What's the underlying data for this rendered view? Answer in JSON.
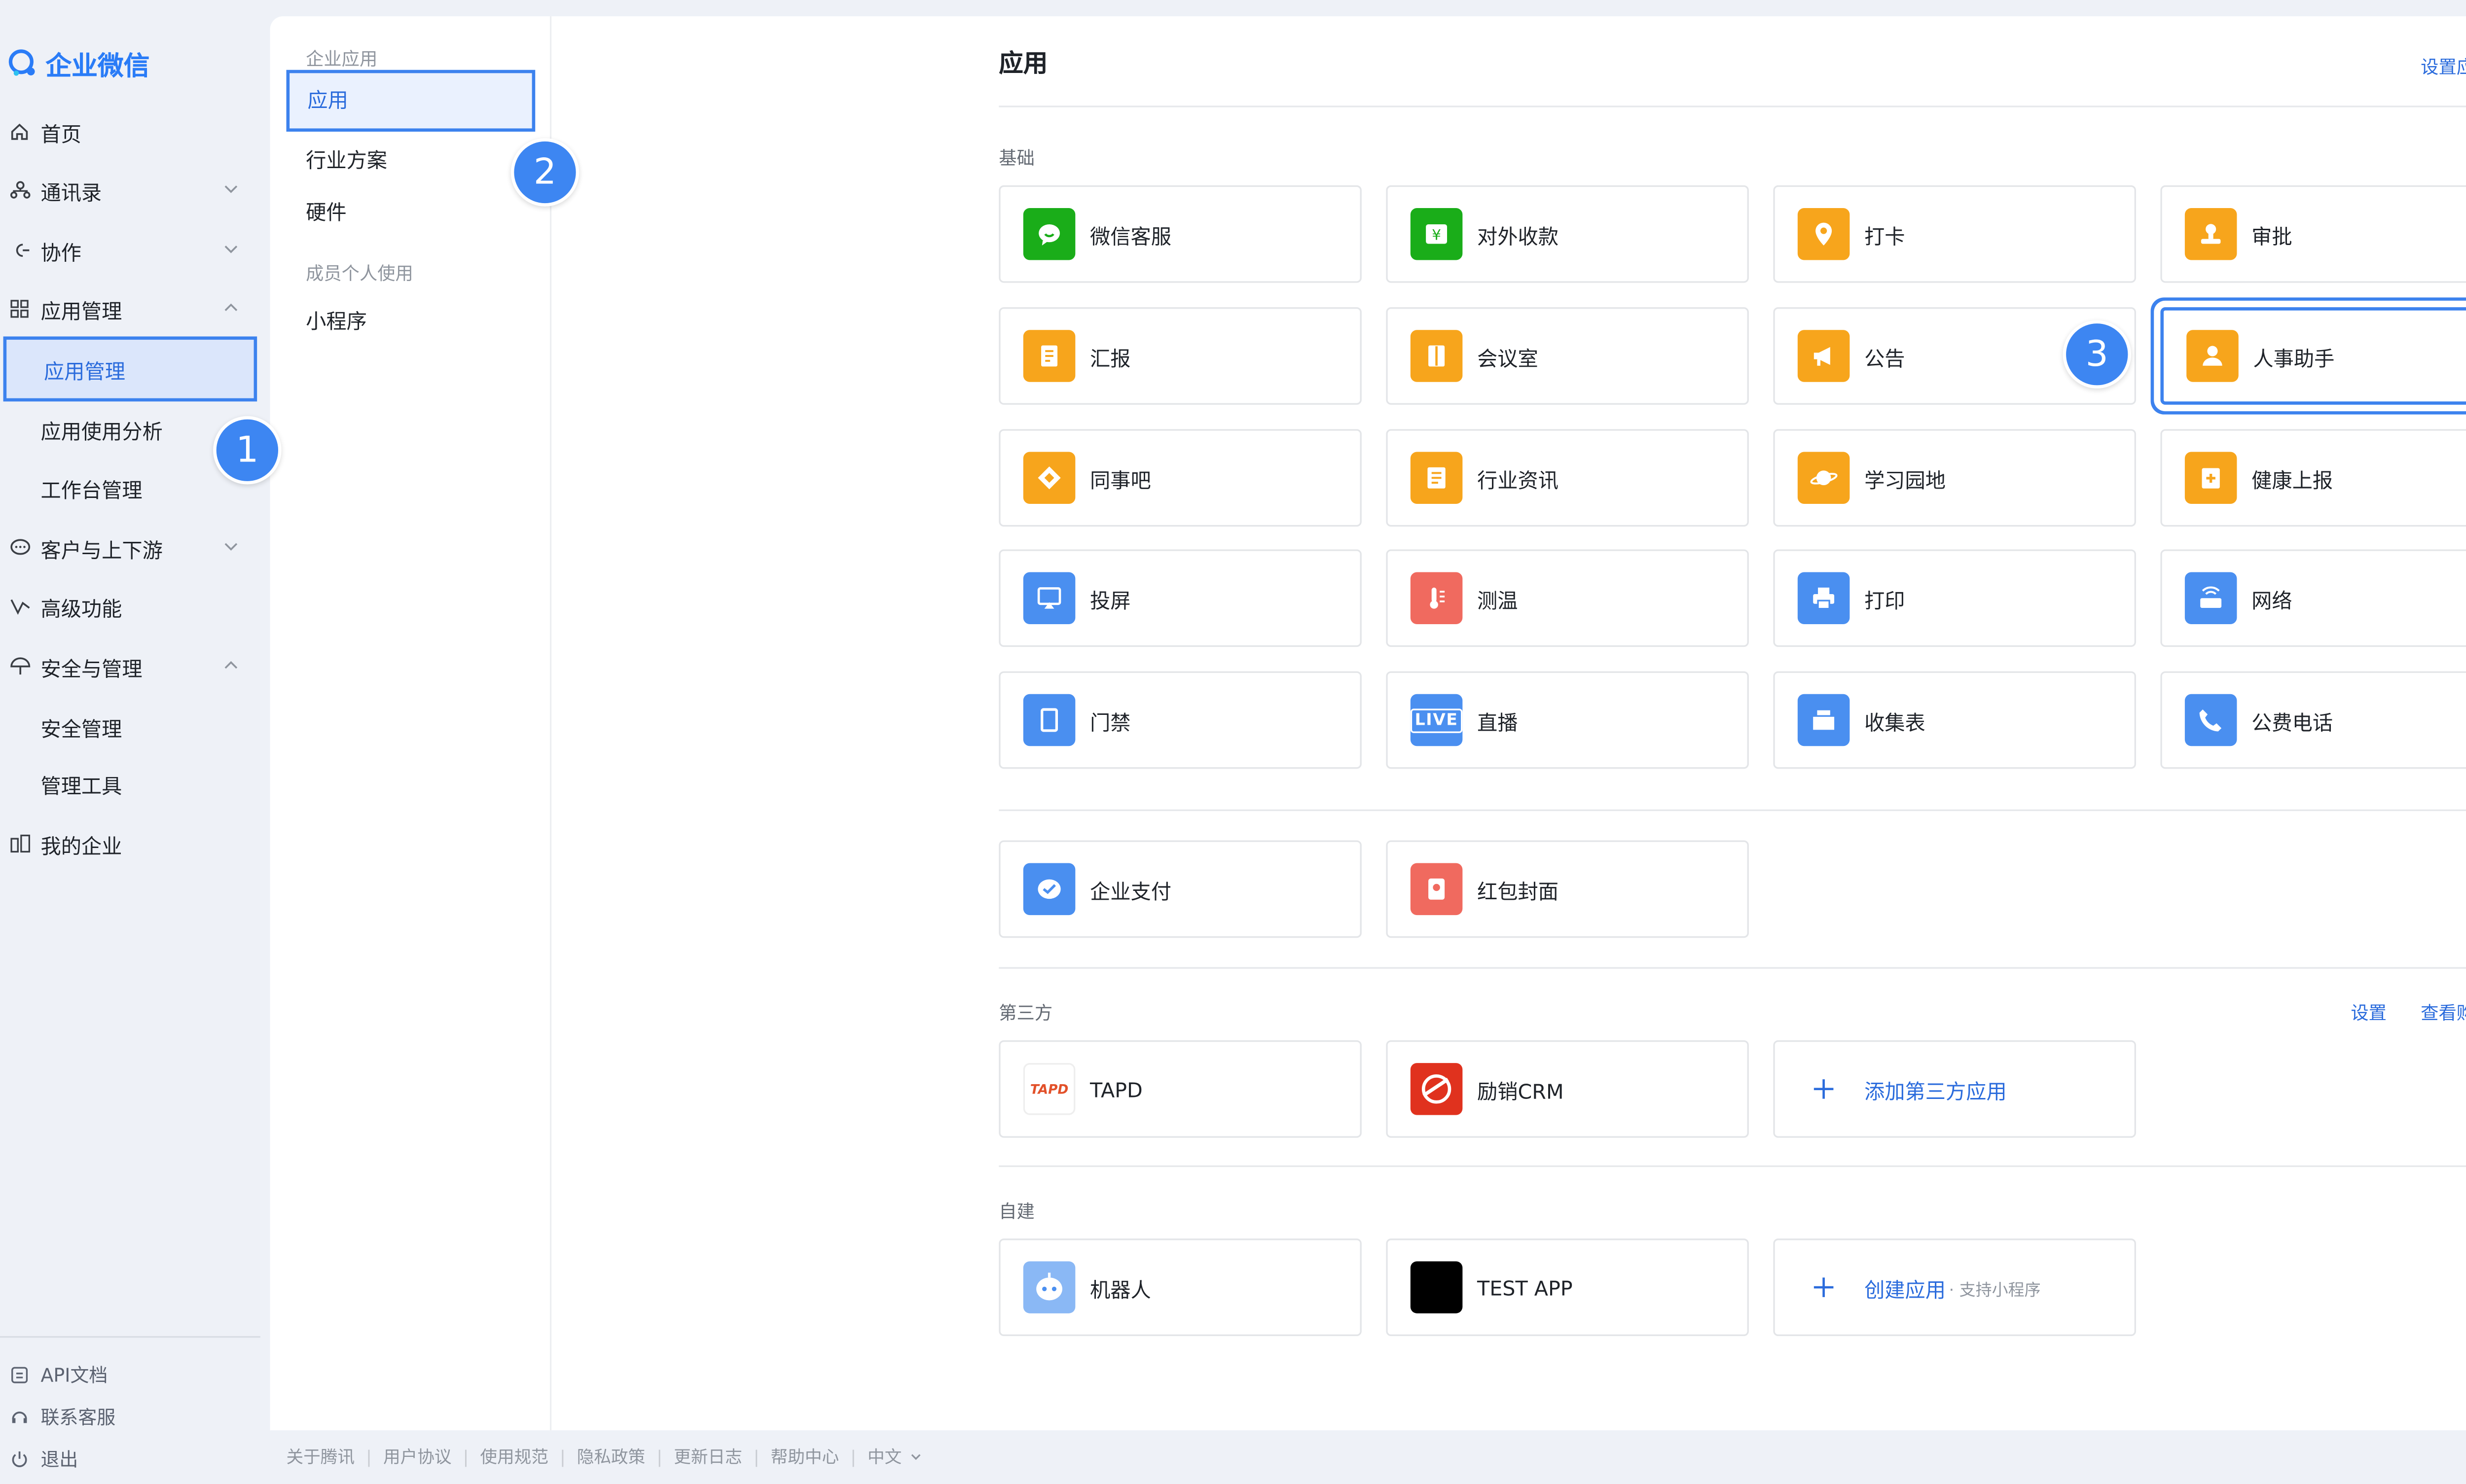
{
  "brand": {
    "name": "企业微信",
    "color": "#2a7cf7"
  },
  "sidebar": {
    "items": [
      {
        "label": "首页",
        "icon": "home-icon"
      },
      {
        "label": "通讯录",
        "icon": "contacts-icon",
        "expand": "down"
      },
      {
        "label": "协作",
        "icon": "collab-icon",
        "expand": "down"
      },
      {
        "label": "应用管理",
        "icon": "apps-grid-icon",
        "expand": "up"
      },
      {
        "label": "应用管理",
        "sub": true,
        "active": true
      },
      {
        "label": "应用使用分析",
        "sub": true
      },
      {
        "label": "工作台管理",
        "sub": true
      },
      {
        "label": "客户与上下游",
        "icon": "chat-bubble-icon",
        "expand": "down"
      },
      {
        "label": "高级功能",
        "icon": "advanced-icon"
      },
      {
        "label": "安全与管理",
        "icon": "umbrella-icon",
        "expand": "up"
      },
      {
        "label": "安全管理",
        "sub": true
      },
      {
        "label": "管理工具",
        "sub": true
      },
      {
        "label": "我的企业",
        "icon": "building-icon"
      }
    ],
    "bottom": [
      {
        "label": "API文档",
        "icon": "api-doc-icon"
      },
      {
        "label": "联系客服",
        "icon": "headset-icon"
      },
      {
        "label": "退出",
        "icon": "power-icon"
      }
    ]
  },
  "subnav": {
    "group1": "企业应用",
    "items1": [
      "应用",
      "行业方案",
      "硬件"
    ],
    "group2": "成员个人使用",
    "items2": [
      "小程序"
    ]
  },
  "badges": [
    "1",
    "2",
    "3"
  ],
  "main": {
    "title": "应用",
    "set_group_link": "设置应用分组",
    "basic_label": "基础",
    "basic_apps": [
      {
        "label": "微信客服",
        "color": "#1aad19",
        "icon": "wechat-service-icon"
      },
      {
        "label": "对外收款",
        "color": "#1aad19",
        "icon": "payment-receive-icon"
      },
      {
        "label": "打卡",
        "color": "#f7a51c",
        "icon": "location-pin-icon"
      },
      {
        "label": "审批",
        "color": "#f7a51c",
        "icon": "approval-stamp-icon"
      },
      {
        "label": "汇报",
        "color": "#f7a51c",
        "icon": "report-doc-icon"
      },
      {
        "label": "会议室",
        "color": "#f7a51c",
        "icon": "meeting-room-icon"
      },
      {
        "label": "公告",
        "color": "#f7a51c",
        "icon": "megaphone-icon"
      },
      {
        "label": "人事助手",
        "color": "#f7a51c",
        "icon": "hr-assistant-icon"
      },
      {
        "label": "同事吧",
        "color": "#f7a51c",
        "icon": "colleague-bar-icon"
      },
      {
        "label": "行业资讯",
        "color": "#f7a51c",
        "icon": "news-icon"
      },
      {
        "label": "学习园地",
        "color": "#f7a51c",
        "icon": "learning-planet-icon"
      },
      {
        "label": "健康上报",
        "color": "#f7a51c",
        "icon": "health-report-icon"
      },
      {
        "label": "投屏",
        "color": "#4a8ff0",
        "icon": "screen-cast-icon"
      },
      {
        "label": "测温",
        "color": "#f06a5f",
        "icon": "thermometer-icon"
      },
      {
        "label": "打印",
        "color": "#4a8ff0",
        "icon": "printer-icon"
      },
      {
        "label": "网络",
        "color": "#4a8ff0",
        "icon": "network-router-icon"
      },
      {
        "label": "门禁",
        "color": "#4a8ff0",
        "icon": "access-door-icon"
      },
      {
        "label": "直播",
        "color": "#4a8ff0",
        "icon": "live-stream-icon",
        "tile_text": "LIVE"
      },
      {
        "label": "收集表",
        "color": "#4a8ff0",
        "icon": "form-collect-icon"
      },
      {
        "label": "公费电话",
        "color": "#4a8ff0",
        "icon": "phone-icon"
      }
    ],
    "pay_apps": [
      {
        "label": "企业支付",
        "color": "#4a8ff0",
        "icon": "enterprise-pay-icon"
      },
      {
        "label": "红包封面",
        "color": "#f06a5f",
        "icon": "red-packet-icon"
      }
    ],
    "third_label": "第三方",
    "third_settings": "设置",
    "third_orders": "查看购买订单",
    "third_apps": [
      {
        "label": "TAPD",
        "icon": "tapd-logo-icon",
        "tile_text": "TAPD"
      },
      {
        "label": "励销CRM",
        "color": "#e0321e",
        "icon": "crm-logo-icon"
      },
      {
        "label": "添加第三方应用",
        "icon": "plus-icon",
        "add": true
      }
    ],
    "self_label": "自建",
    "self_apps": [
      {
        "label": "机器人",
        "color": "#8ab8f5",
        "icon": "robot-icon"
      },
      {
        "label": "TEST APP",
        "color": "#000000",
        "icon": "app-black-icon"
      },
      {
        "label": "创建应用",
        "sub": "· 支持小程序",
        "icon": "plus-icon",
        "add": true
      }
    ]
  },
  "footer": [
    "关于腾讯",
    "用户协议",
    "使用规范",
    "隐私政策",
    "更新日志",
    "帮助中心",
    "中文"
  ],
  "accent": "#3c82ee"
}
